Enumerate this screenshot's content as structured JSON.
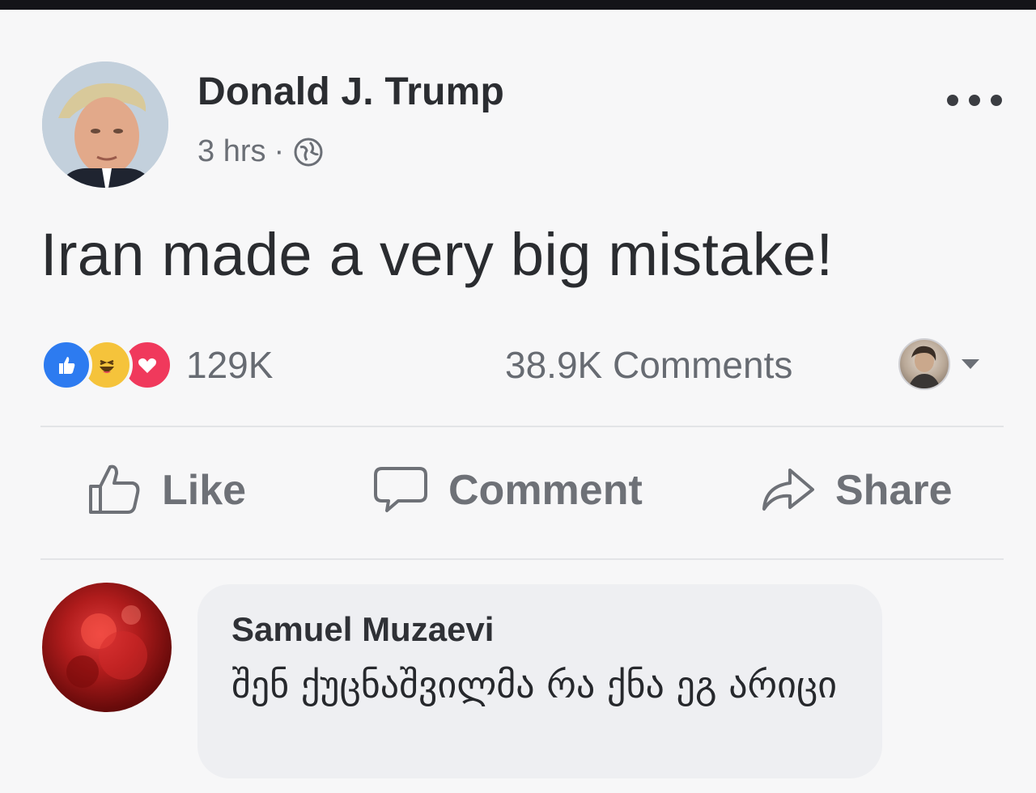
{
  "post": {
    "author": "Donald J. Trump",
    "time": "3 hrs",
    "separator": "·",
    "privacy_icon": "globe-icon",
    "more_icon": "more-dots-icon",
    "text": "Iran made a very big mistake!"
  },
  "stats": {
    "reactions": [
      "like",
      "haha",
      "love"
    ],
    "reaction_count": "129K",
    "comments_count": "38.9K Comments"
  },
  "actions": {
    "like_label": "Like",
    "comment_label": "Comment",
    "share_label": "Share"
  },
  "comment": {
    "author": "Samuel Muzaevi",
    "text": "შენ ქუცნაშვილმა რა ქნა ეგ არიცი"
  },
  "colors": {
    "like_blue": "#2d7bf0",
    "haha_yellow": "#f5c33b",
    "love_red": "#f0395c",
    "muted_text": "#6e7177"
  }
}
